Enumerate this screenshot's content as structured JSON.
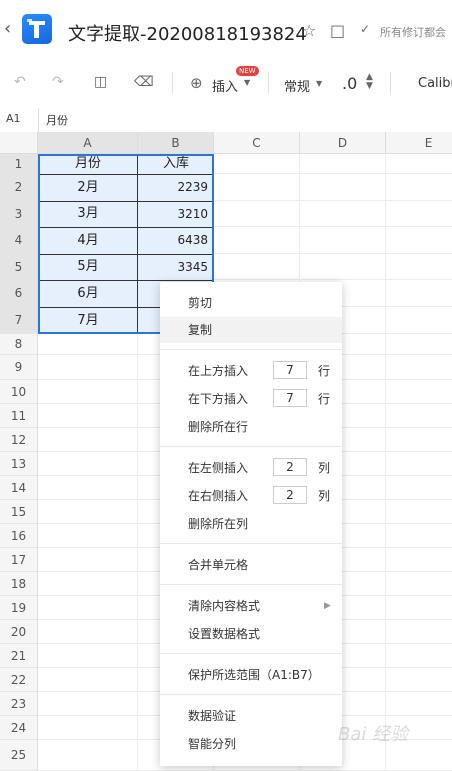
{
  "app": {
    "doc_title": "文字提取-20200818193824",
    "revision_text": "所有修订都会",
    "back_icon": "chevron-left-icon"
  },
  "toolbar": {
    "insert_label": "插入",
    "new_badge": "NEW",
    "format_label": "常规",
    "decimal_label": ".0",
    "font_label": "Calibri"
  },
  "formula_bar": {
    "cell_ref": "A1",
    "value": "月份"
  },
  "grid": {
    "columns": [
      "A",
      "B",
      "C",
      "D",
      "E"
    ],
    "rows": [
      "1",
      "2",
      "3",
      "4",
      "5",
      "6",
      "7",
      "8",
      "9",
      "10",
      "11",
      "12",
      "13",
      "14",
      "15",
      "16",
      "17",
      "18",
      "19",
      "20",
      "21",
      "22",
      "23",
      "24",
      "25"
    ],
    "data": [
      {
        "a": "月份",
        "b": "入库"
      },
      {
        "a": "2月",
        "b": "2239"
      },
      {
        "a": "3月",
        "b": "3210"
      },
      {
        "a": "4月",
        "b": "6438"
      },
      {
        "a": "5月",
        "b": "3345"
      },
      {
        "a": "6月",
        "b": ""
      },
      {
        "a": "7月",
        "b": ""
      }
    ]
  },
  "menu": {
    "cut": "剪切",
    "copy": "复制",
    "insert_above": "在上方插入",
    "insert_above_count": "7",
    "row_unit": "行",
    "insert_below": "在下方插入",
    "insert_below_count": "7",
    "row_unit2": "行",
    "delete_row": "删除所在行",
    "insert_left": "在左侧插入",
    "insert_left_count": "2",
    "col_unit": "列",
    "insert_right": "在右侧插入",
    "insert_right_count": "2",
    "col_unit2": "列",
    "delete_col": "删除所在列",
    "merge": "合并单元格",
    "clear_format": "清除内容格式",
    "set_format": "设置数据格式",
    "protect": "保护所选范围（A1:B7）",
    "validation": "数据验证",
    "split": "智能分列"
  },
  "watermark": "Bai 经验"
}
